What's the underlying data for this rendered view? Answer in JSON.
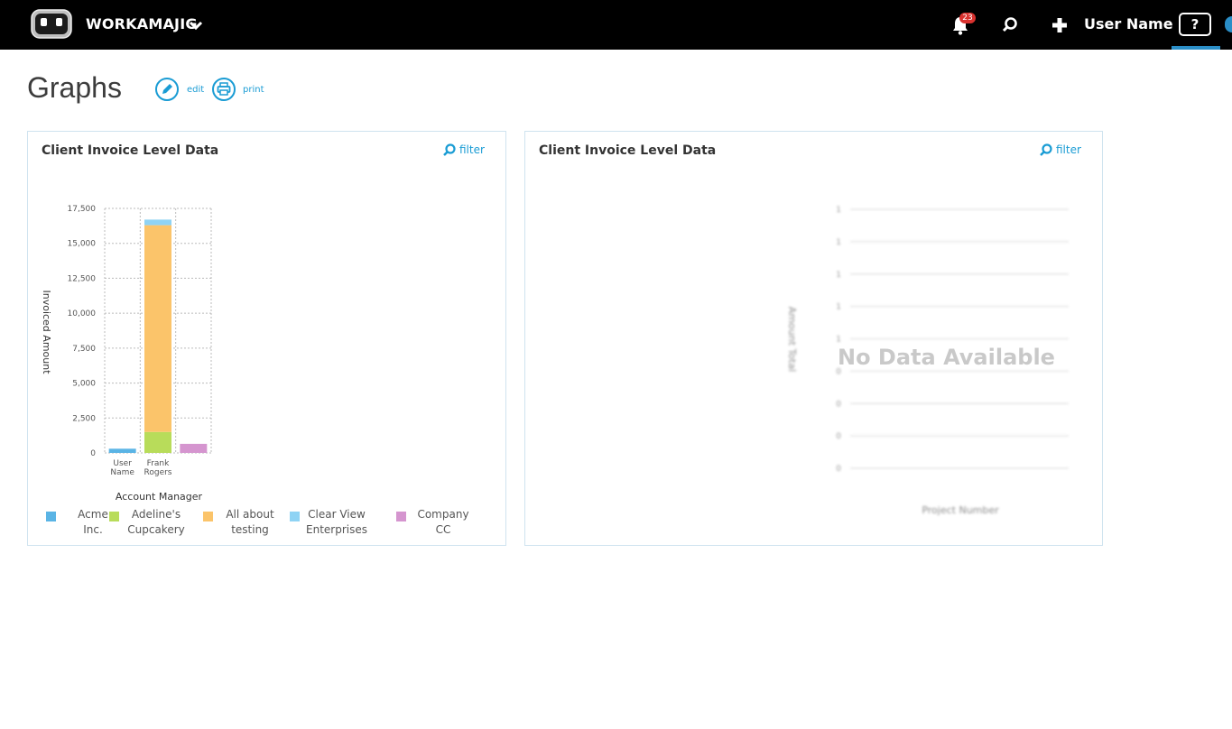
{
  "app": {
    "name": "WORKAMAJIG"
  },
  "header": {
    "notification_count": "23",
    "user_name": "User Name",
    "help_label": "?"
  },
  "page": {
    "title": "Graphs",
    "edit_label": "edit",
    "print_label": "print"
  },
  "panels": [
    {
      "title": "Client Invoice Level Data",
      "filter_label": "filter",
      "chart_data": {
        "type": "bar",
        "stacked": true,
        "xlabel": "Account Manager",
        "ylabel": "Invoiced Amount",
        "ylim": [
          0,
          17500
        ],
        "yticks": [
          "17,500",
          "15,000",
          "12,500",
          "10,000",
          "7,500",
          "5,000",
          "2,500",
          "0"
        ],
        "grid": true,
        "legend_position": "bottom",
        "categories": [
          [
            "User",
            "Name"
          ],
          [
            "Frank",
            "Rogers"
          ],
          [
            "",
            ""
          ]
        ],
        "series": [
          {
            "name": "Acme Inc.",
            "color": "#5ab4e5",
            "values": [
              300,
              0,
              0
            ]
          },
          {
            "name": "Adeline's Cupcakery",
            "color": "#b8dc5a",
            "values": [
              0,
              1500,
              0
            ]
          },
          {
            "name": "All about testing",
            "color": "#fbc46a",
            "values": [
              0,
              14800,
              0
            ]
          },
          {
            "name": "Clear View Enterprises",
            "color": "#8fd3f4",
            "values": [
              0,
              400,
              0
            ]
          },
          {
            "name": "Company CC",
            "color": "#d595cf",
            "values": [
              0,
              0,
              650
            ]
          }
        ],
        "legend": [
          {
            "lines": [
              "Acme",
              "Inc."
            ],
            "color": "#5ab4e5"
          },
          {
            "lines": [
              "Adeline's",
              "Cupcakery"
            ],
            "color": "#b8dc5a"
          },
          {
            "lines": [
              "All about",
              "testing"
            ],
            "color": "#fbc46a"
          },
          {
            "lines": [
              "Clear View",
              "Enterprises"
            ],
            "color": "#8fd3f4"
          },
          {
            "lines": [
              "Company",
              "CC"
            ],
            "color": "#d595cf"
          }
        ]
      }
    },
    {
      "title": "Client Invoice Level Data",
      "filter_label": "filter",
      "no_data_text": "No Data Available",
      "placeholder_axis": {
        "xlabel": "Project Number",
        "ylabel": "Amount Total",
        "yticks": [
          "1",
          "1",
          "1",
          "1",
          "1",
          "0",
          "0",
          "0",
          "0"
        ]
      }
    }
  ]
}
